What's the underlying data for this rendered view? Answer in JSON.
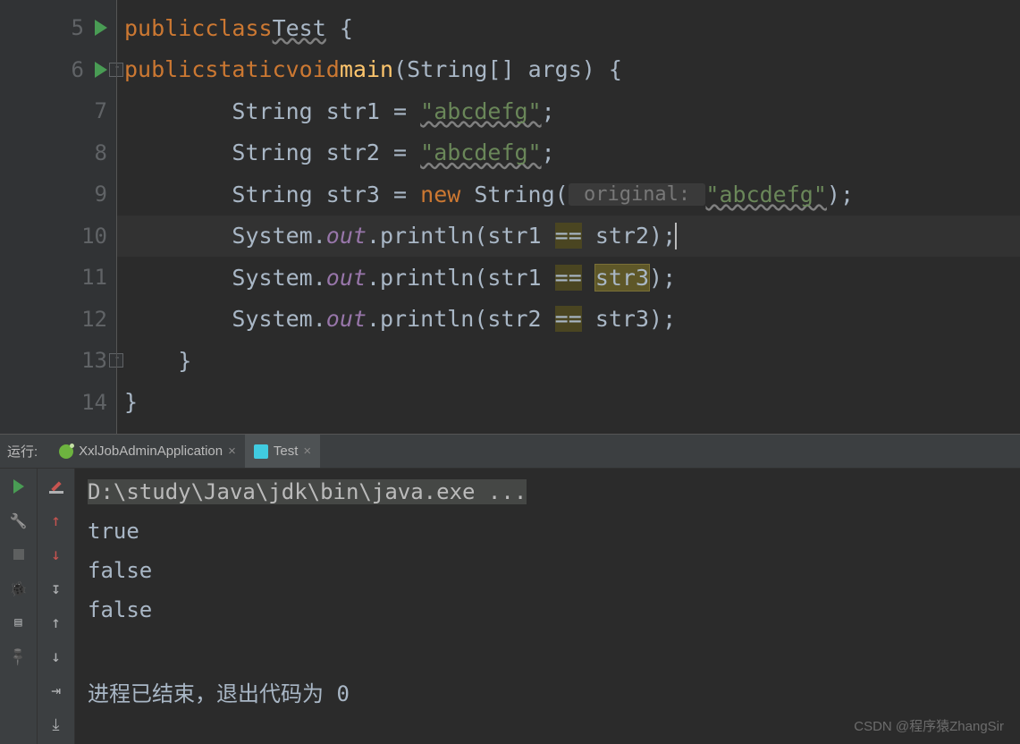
{
  "editor": {
    "lines": [
      {
        "num": "5"
      },
      {
        "num": "6"
      },
      {
        "num": "7"
      },
      {
        "num": "8"
      },
      {
        "num": "9"
      },
      {
        "num": "10"
      },
      {
        "num": "11"
      },
      {
        "num": "12"
      },
      {
        "num": "13"
      },
      {
        "num": "14"
      }
    ],
    "code": {
      "kw_public": "public",
      "kw_class": "class",
      "cls_Test": "Test",
      "brace_open": " {",
      "kw_static": "static",
      "kw_void": "void",
      "fn_main": "main",
      "main_params_open": "(String[] args) {",
      "line7_a": "        String str1 = ",
      "line7_str": "\"abcdefg\"",
      "semicolon": ";",
      "line8_a": "        String str2 = ",
      "line8_str": "\"abcdefg\"",
      "line9_a": "        String str3 = ",
      "kw_new": "new",
      "line9_b": " String(",
      "hint_original": " original: ",
      "line9_str": "\"abcdefg\"",
      "line9_close": ");",
      "line10_a": "        System.",
      "field_out": "out",
      "line10_b": ".println(str1 ",
      "op_eq": "==",
      "line10_c": " str2);",
      "line11_b": ".println(str1 ",
      "line11_c": " ",
      "line11_str3": "str3",
      "line11_close": ");",
      "line12_b": ".println(str2 ",
      "line12_c": " str3);",
      "brace_close_inner": "    }",
      "brace_close_outer": "}"
    }
  },
  "run": {
    "label": "运行:",
    "tab1": "XxlJobAdminApplication",
    "tab2": "Test",
    "cmd": "D:\\study\\Java\\jdk\\bin\\java.exe ...",
    "out1": "true",
    "out2": "false",
    "out3": "false",
    "exit": "进程已结束，退出代码为 0"
  },
  "watermark": "CSDN @程序猿ZhangSir"
}
